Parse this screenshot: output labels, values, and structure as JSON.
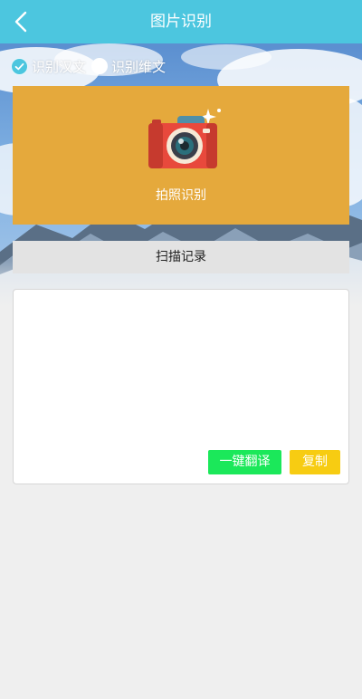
{
  "header": {
    "title": "图片识别",
    "back_icon": "chevron-left-icon"
  },
  "mode": {
    "options": [
      {
        "label": "识别汉文",
        "selected": true
      },
      {
        "label": "识别维文",
        "selected": false
      }
    ]
  },
  "camera": {
    "label": "拍照识别",
    "icon": "camera-icon"
  },
  "history": {
    "label": "扫描记录"
  },
  "result": {
    "text": "",
    "translate_label": "一键翻译",
    "copy_label": "复制"
  },
  "colors": {
    "header": "#4cc6df",
    "camera_card": "#e5a93c",
    "translate_button": "#1be85a",
    "copy_button": "#f7cc12",
    "background": "#efefef"
  }
}
